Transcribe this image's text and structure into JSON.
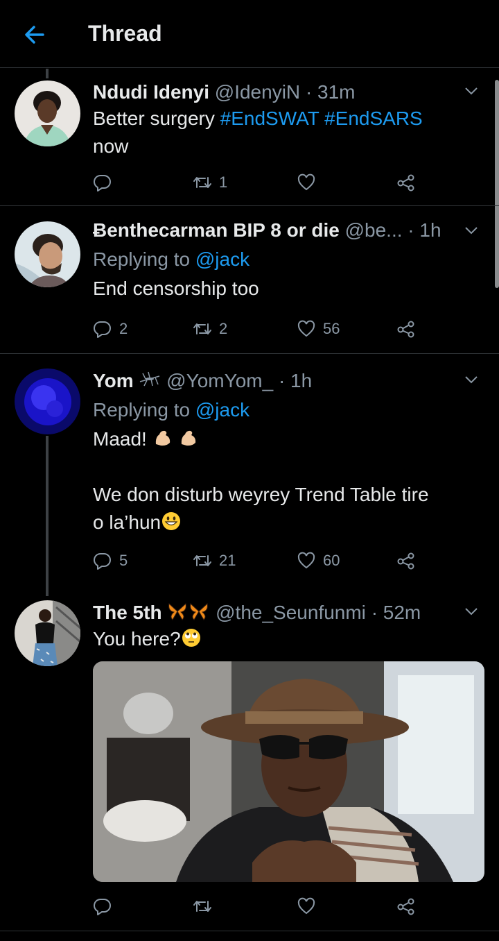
{
  "header": {
    "title": "Thread"
  },
  "tweets": [
    {
      "name": "Ndudi Idenyi",
      "handle": "@IdenyiN",
      "time": "· 31m",
      "text_plain": "Better surgery ",
      "tag1": "#EndSWAT",
      "tag2": "#EndSARS",
      "text_line2": "now",
      "reply_count": "",
      "retweet_count": "1",
      "like_count": ""
    },
    {
      "name": "Ƀenthecarman BIP 8 or die",
      "handle": "@be...",
      "time": "· 1h",
      "replying_prefix": "Replying to",
      "replying_mention": "@jack",
      "text": "End censorship too",
      "reply_count": "2",
      "retweet_count": "2",
      "like_count": "56"
    },
    {
      "name": "Yom",
      "handle": "@YomYom_",
      "time": "· 1h",
      "replying_prefix": "Replying to",
      "replying_mention": "@jack",
      "text_line1": "Maad!",
      "text_line2": "We don disturb weyrey Trend Table tire",
      "text_line3": "o la’hun",
      "reply_count": "5",
      "retweet_count": "21",
      "like_count": "60"
    },
    {
      "name": "The 5th",
      "handle": "@the_Seunfunmi",
      "time": "· 52m",
      "text": "You here?",
      "reply_count": "",
      "retweet_count": "",
      "like_count": ""
    }
  ],
  "colors": {
    "accent": "#1d9bf0",
    "muted": "#8b98a5",
    "separator": "#2f3336",
    "background": "#000000"
  }
}
